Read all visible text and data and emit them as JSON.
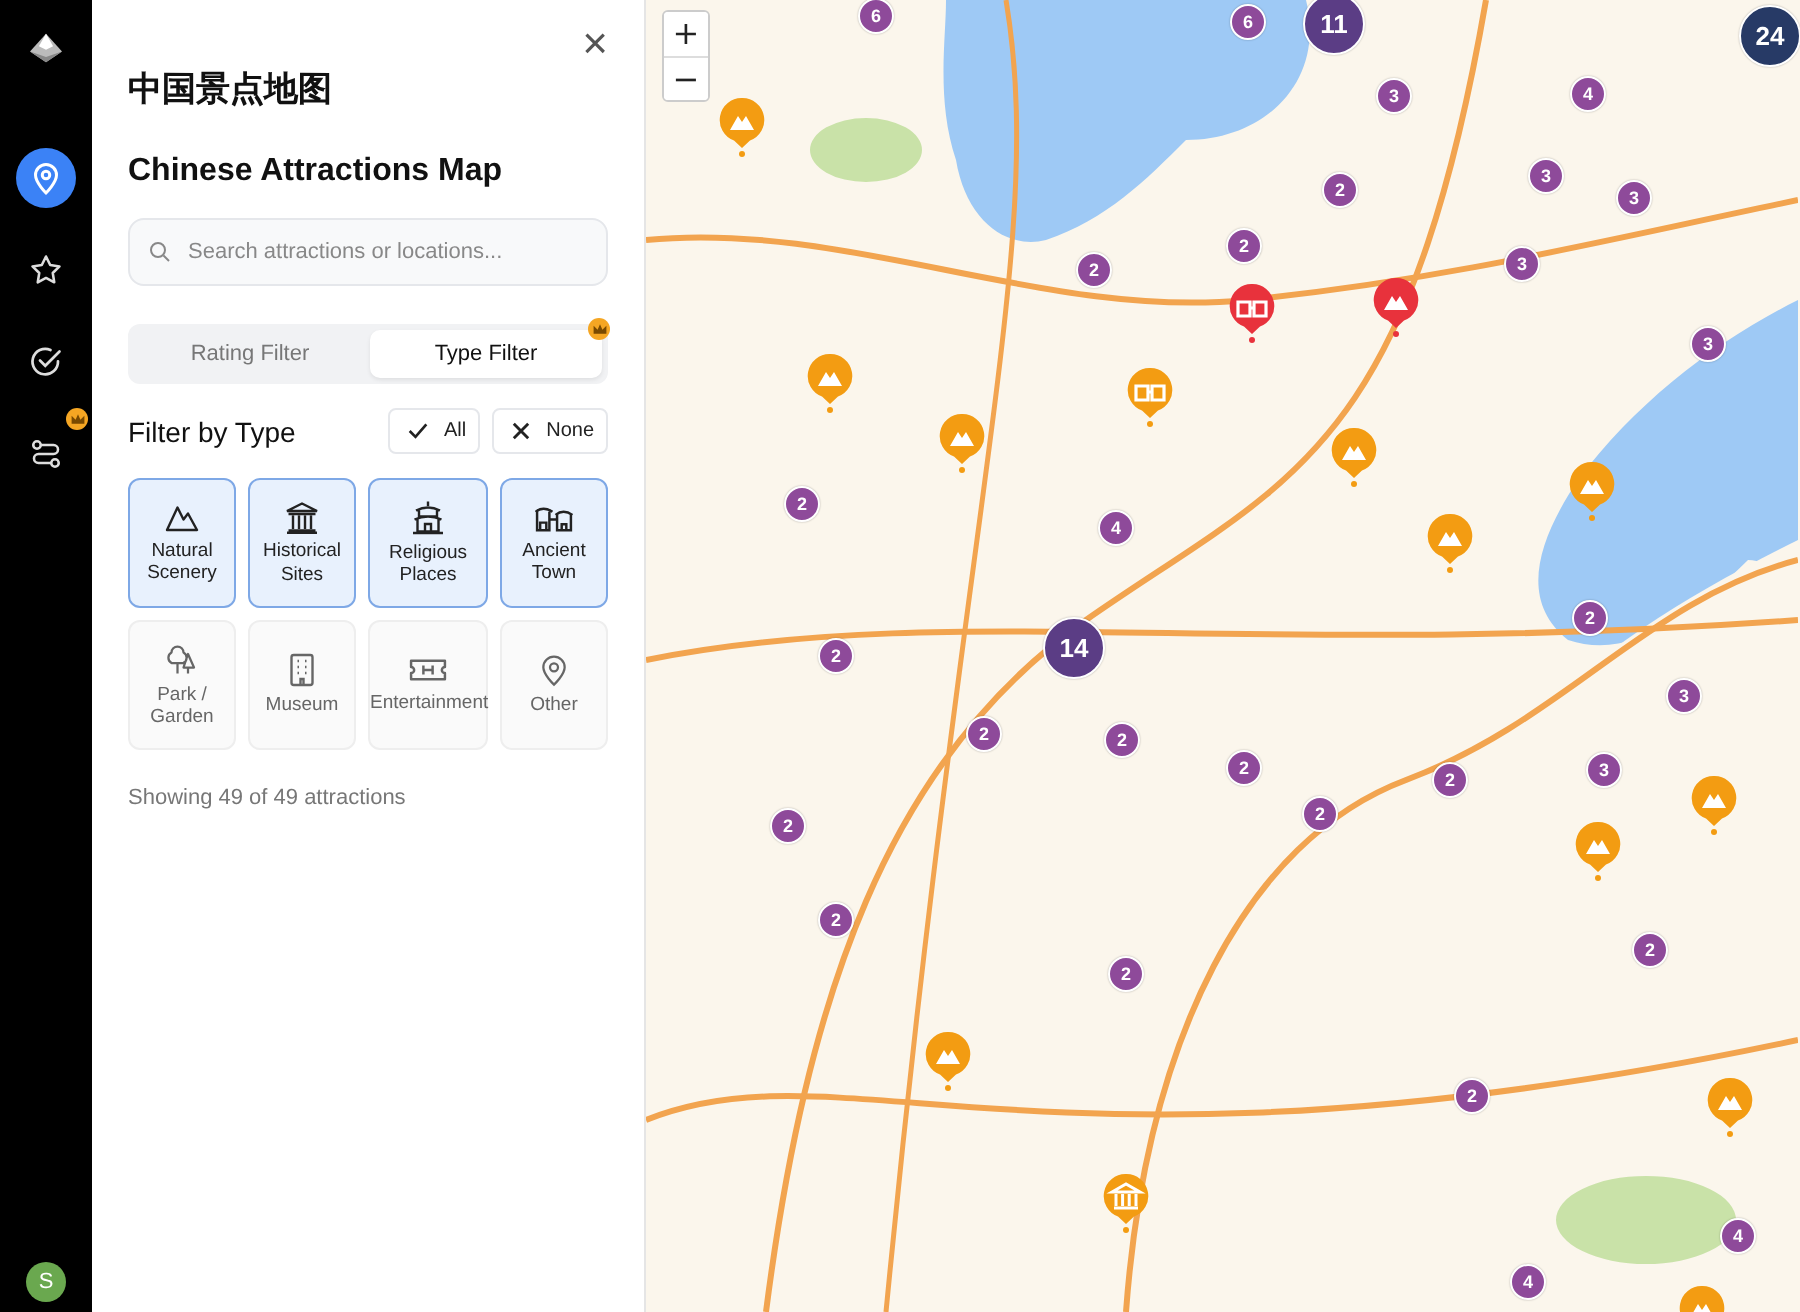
{
  "rail": {
    "items": [
      {
        "kind": "pin",
        "selected": true,
        "premium": false
      },
      {
        "kind": "star",
        "selected": false,
        "premium": false
      },
      {
        "kind": "check",
        "selected": false,
        "premium": false
      },
      {
        "kind": "route",
        "selected": false,
        "premium": true
      }
    ],
    "avatar": "S"
  },
  "panel": {
    "close": "×",
    "title": "中国景点地图",
    "subtitle": "Chinese Attractions Map",
    "search": {
      "placeholder": "Search attractions or locations..."
    },
    "tabs": [
      {
        "label": "Rating Filter",
        "selected": false,
        "premium": false
      },
      {
        "label": "Type Filter",
        "selected": true,
        "premium": true
      }
    ],
    "filter_heading": "Filter by Type",
    "all_button": "All",
    "none_button": "None",
    "types": [
      {
        "kind": "natural",
        "label": "Natural Scenery",
        "selected": true
      },
      {
        "kind": "historical",
        "label": "Historical Sites",
        "selected": true
      },
      {
        "kind": "religious",
        "label": "Religious Places",
        "selected": true
      },
      {
        "kind": "town",
        "label": "Ancient Town",
        "selected": true
      },
      {
        "kind": "park",
        "label": "Park / Garden",
        "selected": false
      },
      {
        "kind": "museum",
        "label": "Museum",
        "selected": false
      },
      {
        "kind": "entertainment",
        "label": "Entertainment",
        "selected": false
      },
      {
        "kind": "other",
        "label": "Other",
        "selected": false
      }
    ],
    "summary": "Showing 49 of 49 attractions"
  },
  "map": {
    "zoom_in": "+",
    "zoom_out": "−",
    "clusters": [
      {
        "count": "6",
        "color": "#8e4a9a"
      },
      {
        "count": "6",
        "color": "#8e4a9a"
      },
      {
        "count": "11",
        "color": "#5b3d85"
      },
      {
        "count": "24",
        "color": "#273a66"
      },
      {
        "count": "3",
        "color": "#8e4a9a"
      },
      {
        "count": "4",
        "color": "#8e4a9a"
      },
      {
        "count": "3",
        "color": "#8e4a9a"
      },
      {
        "count": "2",
        "color": "#8e4a9a"
      },
      {
        "count": "3",
        "color": "#8e4a9a"
      },
      {
        "count": "2",
        "color": "#8e4a9a"
      },
      {
        "count": "2",
        "color": "#8e4a9a"
      },
      {
        "count": "3",
        "color": "#8e4a9a"
      },
      {
        "count": "3",
        "color": "#8e4a9a"
      },
      {
        "count": "2",
        "color": "#8e4a9a"
      },
      {
        "count": "4",
        "color": "#8e4a9a"
      },
      {
        "count": "2",
        "color": "#8e4a9a"
      },
      {
        "count": "14",
        "color": "#5b3d85"
      },
      {
        "count": "2",
        "color": "#8e4a9a"
      },
      {
        "count": "3",
        "color": "#8e4a9a"
      },
      {
        "count": "2",
        "color": "#8e4a9a"
      },
      {
        "count": "2",
        "color": "#8e4a9a"
      },
      {
        "count": "2",
        "color": "#8e4a9a"
      },
      {
        "count": "2",
        "color": "#8e4a9a"
      },
      {
        "count": "3",
        "color": "#8e4a9a"
      },
      {
        "count": "2",
        "color": "#8e4a9a"
      },
      {
        "count": "2",
        "color": "#8e4a9a"
      },
      {
        "count": "2",
        "color": "#8e4a9a"
      },
      {
        "count": "2",
        "color": "#8e4a9a"
      },
      {
        "count": "2",
        "color": "#8e4a9a"
      },
      {
        "count": "2",
        "color": "#8e4a9a"
      },
      {
        "count": "4",
        "color": "#8e4a9a"
      },
      {
        "count": "4",
        "color": "#8e4a9a"
      }
    ],
    "markers": [
      {
        "kind": "mountain",
        "color": "#f39c12"
      },
      {
        "kind": "mountain",
        "color": "#f39c12"
      },
      {
        "kind": "mountain",
        "color": "#f39c12"
      },
      {
        "kind": "mountain",
        "color": "#f39c12"
      },
      {
        "kind": "mountain",
        "color": "#f39c12"
      },
      {
        "kind": "mountain",
        "color": "#f39c12"
      },
      {
        "kind": "mountain",
        "color": "#f39c12"
      },
      {
        "kind": "mountain",
        "color": "#f39c12"
      },
      {
        "kind": "mountain",
        "color": "#f39c12"
      },
      {
        "kind": "mountain",
        "color": "#f39c12"
      },
      {
        "kind": "mountain",
        "color": "#f39c12"
      },
      {
        "kind": "town",
        "color": "#f39c12"
      },
      {
        "kind": "town",
        "color": "#e8323c"
      },
      {
        "kind": "mountain",
        "color": "#e8323c"
      },
      {
        "kind": "museum",
        "color": "#f39c12"
      }
    ]
  }
}
